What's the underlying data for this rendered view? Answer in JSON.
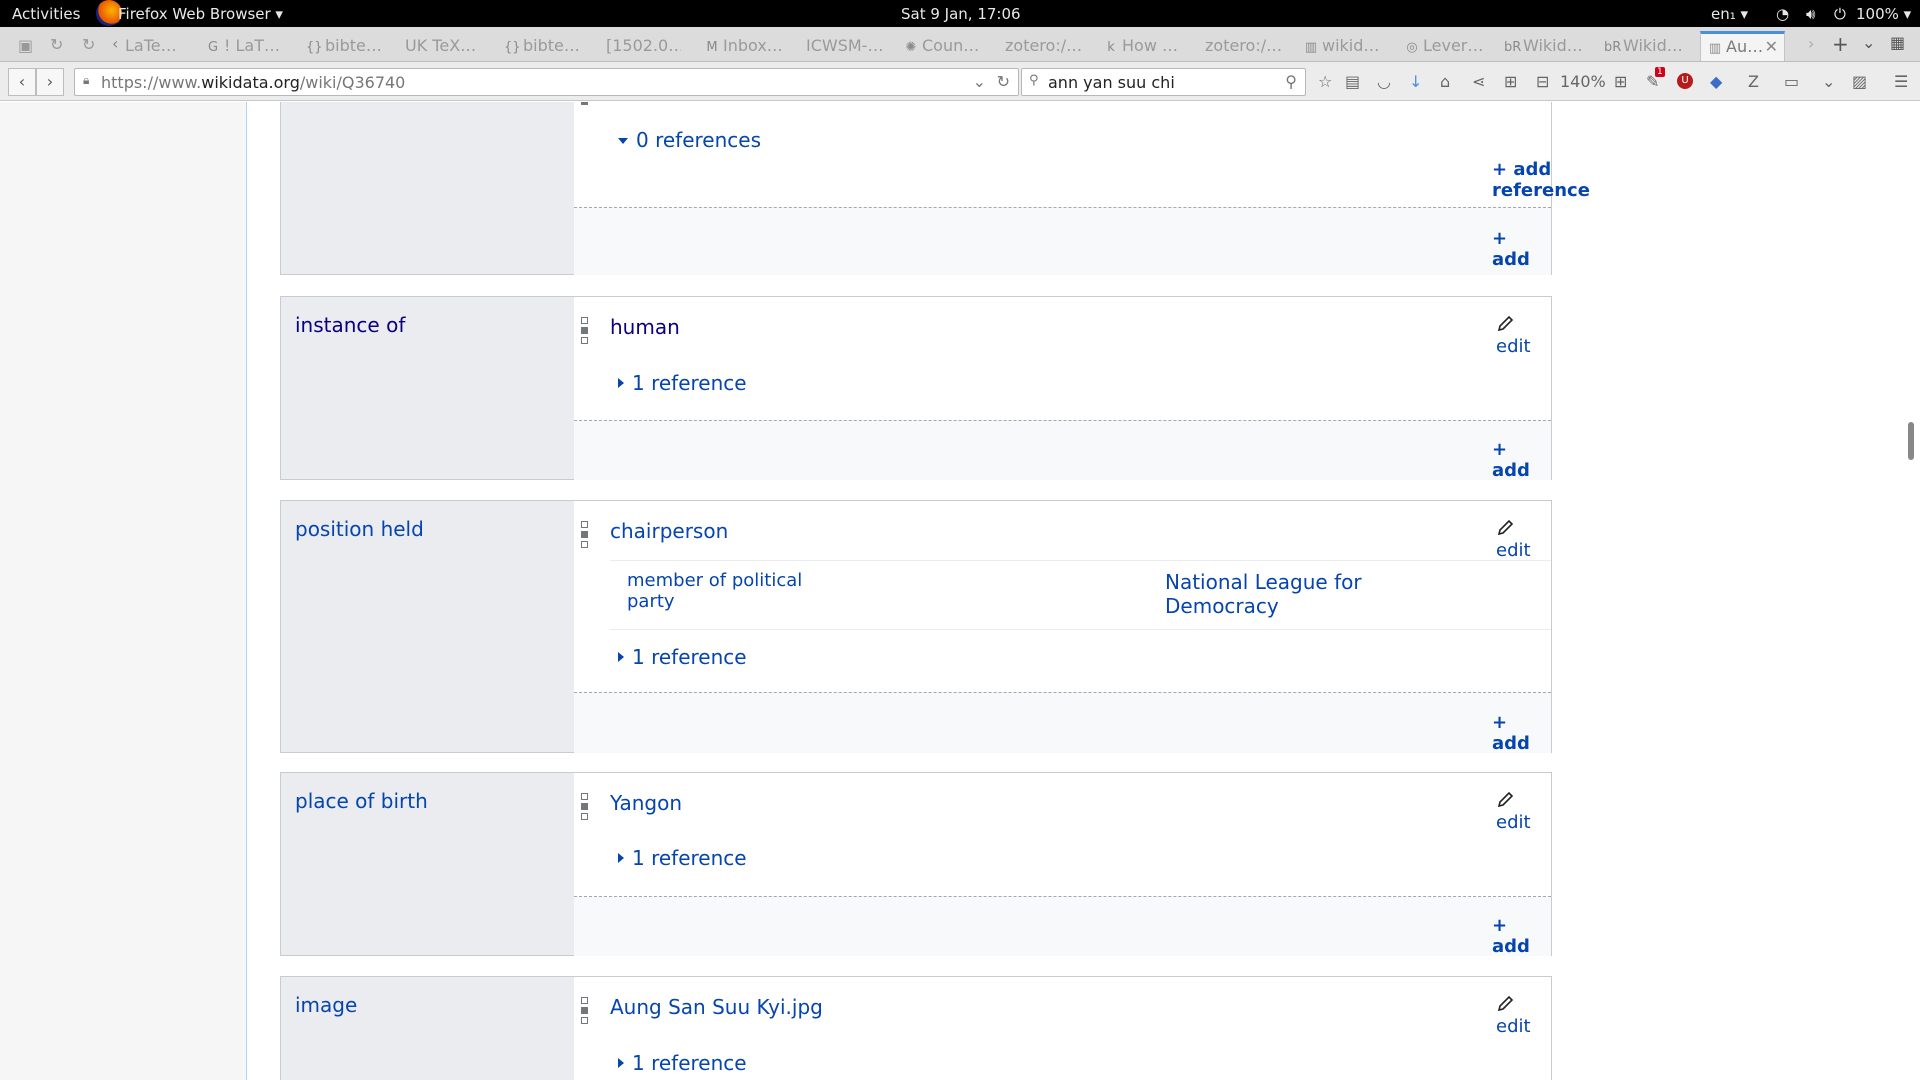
{
  "system_bar": {
    "activities": "Activities",
    "app_menu": "Firefox Web Browser ▾",
    "clock": "Sat  9 Jan, 17:06",
    "lang": "en₁ ▾",
    "battery": "100% ▾"
  },
  "tabs": [
    {
      "label": "LaTe…"
    },
    {
      "label": "! LaT…"
    },
    {
      "label": "bibte…"
    },
    {
      "label": "UK TeX…"
    },
    {
      "label": "bibte…"
    },
    {
      "label": "[1502.0…"
    },
    {
      "label": "Inbox…"
    },
    {
      "label": "ICWSM-…"
    },
    {
      "label": "Coun…"
    },
    {
      "label": "zotero:/…"
    },
    {
      "label": "How …"
    },
    {
      "label": "zotero:/…"
    },
    {
      "label": "wikid…"
    },
    {
      "label": "Lever…"
    },
    {
      "label": "Wikid…"
    },
    {
      "label": "Wikid…"
    },
    {
      "label": "Au…"
    }
  ],
  "nav": {
    "url_prefix": "https://www.",
    "url_host": "wikidata.org",
    "url_path": "/wiki/Q36740",
    "search_value": "ann yan suu chi",
    "zoom": "140%",
    "badge_count": "1"
  },
  "labels": {
    "edit": "edit",
    "add": "add",
    "add_reference": "add reference"
  },
  "statements": {
    "top": {
      "refs": "0 references"
    },
    "instance_of": {
      "property": "instance of",
      "value": "human",
      "refs": "1 reference"
    },
    "position_held": {
      "property": "position held",
      "value": "chairperson",
      "qualifier_property": "member of political party",
      "qualifier_value": "National League for Democracy",
      "refs": "1 reference"
    },
    "place_of_birth": {
      "property": "place of birth",
      "value": "Yangon",
      "refs": "1 reference"
    },
    "image": {
      "property": "image",
      "value": "Aung San Suu Kyi.jpg",
      "refs": "1 reference"
    }
  },
  "colors": {
    "link": "#0645ad",
    "visited": "#0b0080",
    "prop_bg": "#eaecf0"
  }
}
